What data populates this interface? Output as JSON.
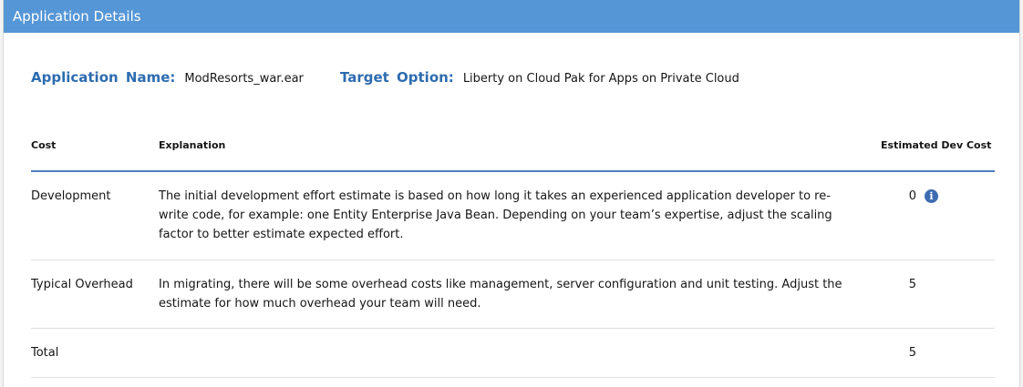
{
  "header": {
    "title": "Application Details"
  },
  "application": {
    "name_label": "Application  Name:",
    "name_value": "ModResorts_war.ear",
    "target_label": "Target  Option:",
    "target_value": "Liberty on Cloud Pak for Apps on Private Cloud"
  },
  "table": {
    "columns": {
      "cost": "Cost",
      "explanation": "Explanation",
      "estimate": "Estimated Dev Cost"
    },
    "rows": [
      {
        "cost": "Development",
        "explanation": "The initial development effort estimate is based on how long it takes an experienced application developer to re-write code, for example: one Entity Enterprise Java Bean. Depending on your team’s expertise, adjust the scaling factor to better estimate expected effort.",
        "value": "0",
        "info_icon": "info-circle-icon"
      },
      {
        "cost": "Typical Overhead",
        "explanation": "In migrating, there will be some overhead costs like management, server configuration and unit testing. Adjust the estimate for how much overhead your team will need.",
        "value": "5"
      },
      {
        "cost": "Total",
        "explanation": "",
        "value": "5"
      }
    ]
  },
  "colors": {
    "header_bg": "#5596d6",
    "label_blue": "#2d6cb0",
    "table_rule": "#4d7fc1",
    "info_icon": "#3d6cb1"
  }
}
